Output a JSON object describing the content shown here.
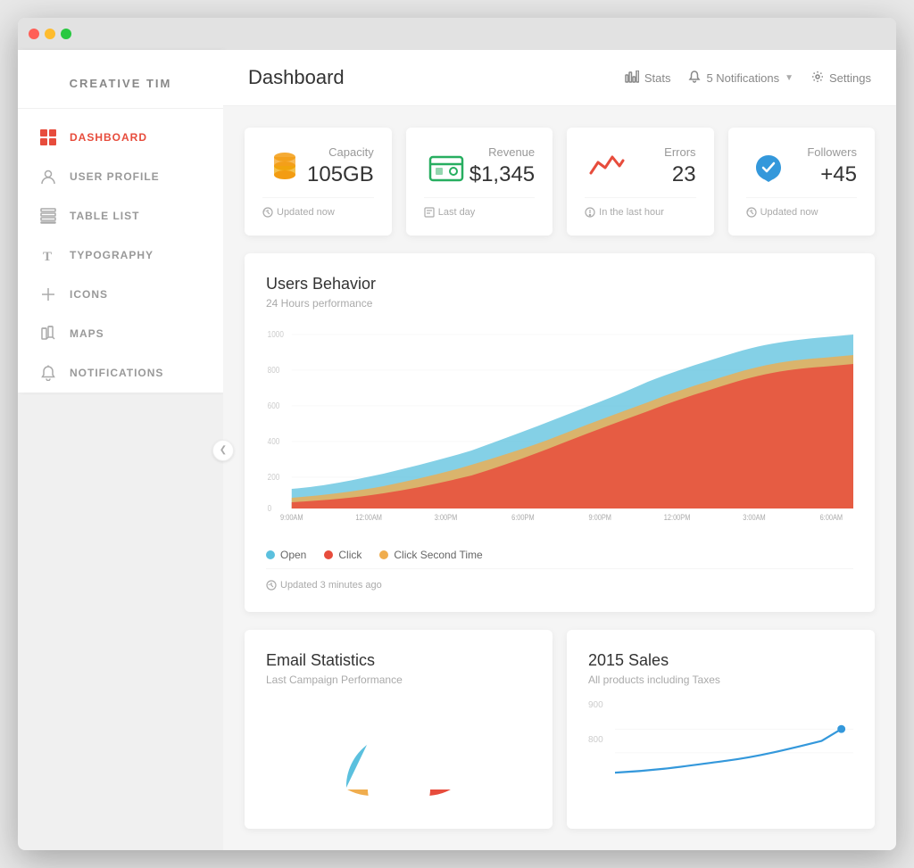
{
  "browser": {
    "dots": [
      "red",
      "yellow",
      "green"
    ]
  },
  "sidebar": {
    "brand": "CREATIVE TIM",
    "collapse_icon": "❮",
    "items": [
      {
        "id": "dashboard",
        "label": "DASHBOARD",
        "icon": "⊞",
        "active": true
      },
      {
        "id": "user-profile",
        "label": "USER PROFILE",
        "icon": "👤",
        "active": false
      },
      {
        "id": "table-list",
        "label": "TABLE LIST",
        "icon": "☰",
        "active": false
      },
      {
        "id": "typography",
        "label": "TYPOGRAPHY",
        "icon": "T",
        "active": false
      },
      {
        "id": "icons",
        "label": "ICONS",
        "icon": "✏",
        "active": false
      },
      {
        "id": "maps",
        "label": "MAPS",
        "icon": "📖",
        "active": false
      },
      {
        "id": "notifications",
        "label": "NOTIFICATIONS",
        "icon": "🔔",
        "active": false
      }
    ]
  },
  "header": {
    "title": "Dashboard",
    "stats_label": "Stats",
    "notifications_label": "5 Notifications",
    "settings_label": "Settings"
  },
  "stat_cards": [
    {
      "id": "capacity",
      "label": "Capacity",
      "value": "105GB",
      "footer": "Updated now",
      "icon_color": "#f39c12",
      "icon": "capacity"
    },
    {
      "id": "revenue",
      "label": "Revenue",
      "value": "$1,345",
      "footer": "Last day",
      "icon_color": "#27ae60",
      "icon": "revenue"
    },
    {
      "id": "errors",
      "label": "Errors",
      "value": "23",
      "footer": "In the last hour",
      "icon_color": "#e74c3c",
      "icon": "errors"
    },
    {
      "id": "followers",
      "label": "Followers",
      "value": "+45",
      "footer": "Updated now",
      "icon_color": "#3498db",
      "icon": "followers"
    }
  ],
  "users_behavior": {
    "title": "Users Behavior",
    "subtitle": "24 Hours performance",
    "footer": "Updated 3 minutes ago",
    "legend": [
      {
        "label": "Open",
        "color": "#5bc0de"
      },
      {
        "label": "Click",
        "color": "#e74c3c"
      },
      {
        "label": "Click Second Time",
        "color": "#f0ad4e"
      }
    ],
    "x_labels": [
      "9:00AM",
      "12:00AM",
      "3:00PM",
      "6:00PM",
      "9:00PM",
      "12:00PM",
      "3:00AM",
      "6:00AM"
    ],
    "y_labels": [
      "1000",
      "800",
      "600",
      "400",
      "200",
      "0"
    ]
  },
  "email_statistics": {
    "title": "Email Statistics",
    "subtitle": "Last Campaign Performance"
  },
  "sales_2015": {
    "title": "2015 Sales",
    "subtitle": "All products including Taxes",
    "y_labels": [
      "900",
      "800"
    ]
  }
}
